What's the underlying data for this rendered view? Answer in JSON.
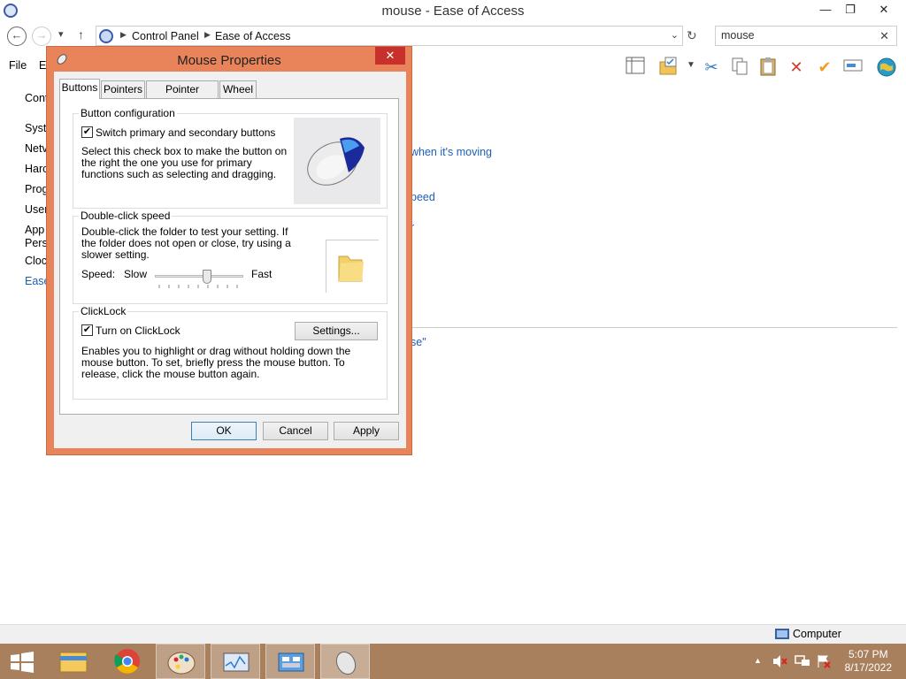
{
  "window": {
    "title": "mouse - Ease of Access",
    "minimize": "—",
    "maximize": "❐",
    "close": "✕"
  },
  "address": {
    "back": "←",
    "forward": "→",
    "up": "↑",
    "history": "▾",
    "breadcrumbs": [
      "Control Panel",
      "Ease of Access"
    ],
    "dropdown": "⌄",
    "refresh": "↻"
  },
  "search": {
    "value": "mouse",
    "clear": "✕"
  },
  "menubar": {
    "file": "File",
    "edit_partial": "E"
  },
  "left_nav": [
    "Cont",
    "Syste",
    "Netv",
    "Harc",
    "Prog",
    "User",
    "App",
    "Pers",
    "Cloc",
    "Ease"
  ],
  "right_fragments": {
    "moving": "when it's moving",
    "speed": "peed",
    "r": "r",
    "quote": "se\""
  },
  "toolbar_icons": [
    "layout-icon",
    "folder-check-icon",
    "scissors-icon",
    "copy-icon",
    "paste-icon",
    "delete-icon",
    "checkmark-icon",
    "rename-icon",
    "globe-icon"
  ],
  "statusbar": {
    "computer": "Computer"
  },
  "taskbar": {
    "apps": [
      "windows-start-icon",
      "file-explorer-icon",
      "chrome-icon",
      "paint-icon",
      "task-manager-icon",
      "control-panel-icon",
      "mouse-icon"
    ],
    "tray_up": "▲",
    "time": "5:07 PM",
    "date": "8/17/2022"
  },
  "dialog": {
    "title": "Mouse Properties",
    "close": "✕",
    "tabs": [
      "Buttons",
      "Pointers",
      "Pointer Options",
      "Wheel"
    ],
    "button_config": {
      "label": "Button configuration",
      "checkbox_label": "Switch primary and secondary buttons",
      "checked": true,
      "description": "Select this check box to make the button on the right the one you use for primary functions such as selecting and dragging."
    },
    "double_click": {
      "label": "Double-click speed",
      "description": "Double-click the folder to test your setting. If the folder does not open or close, try using a slower setting.",
      "speed_label": "Speed:",
      "slow": "Slow",
      "fast": "Fast",
      "speed_value": 0.6
    },
    "clicklock": {
      "label": "ClickLock",
      "checkbox_label": "Turn on ClickLock",
      "checked": true,
      "settings_button": "Settings...",
      "description": "Enables you to highlight or drag without holding down the mouse button. To set, briefly press the mouse button. To release, click the mouse button again."
    },
    "buttons": {
      "ok": "OK",
      "cancel": "Cancel",
      "apply": "Apply"
    }
  },
  "colors": {
    "dialog_frame": "#e8835a",
    "close_red": "#c7302b",
    "link_blue": "#1e5fb4",
    "taskbar": "#a9805e"
  }
}
